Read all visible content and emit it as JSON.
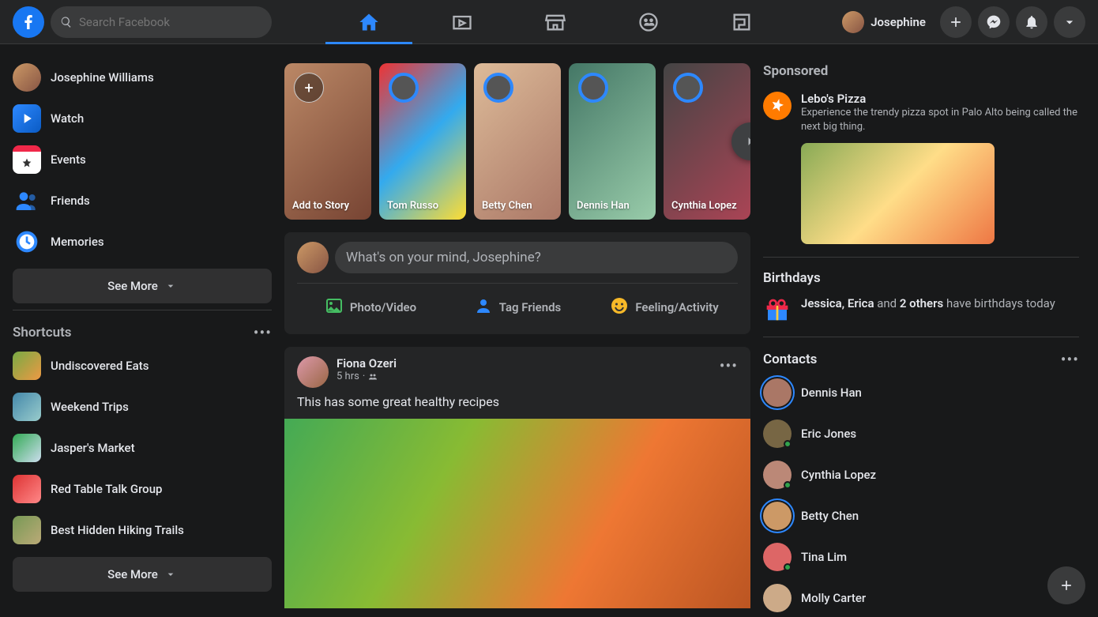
{
  "header": {
    "search_placeholder": "Search Facebook",
    "user_name": "Josephine"
  },
  "sidebar": {
    "profile_name": "Josephine Williams",
    "items": [
      {
        "label": "Watch"
      },
      {
        "label": "Events"
      },
      {
        "label": "Friends"
      },
      {
        "label": "Memories"
      }
    ],
    "see_more": "See More",
    "shortcuts_title": "Shortcuts",
    "shortcuts": [
      {
        "label": "Undiscovered Eats"
      },
      {
        "label": "Weekend Trips"
      },
      {
        "label": "Jasper's Market"
      },
      {
        "label": "Red Table Talk Group"
      },
      {
        "label": "Best Hidden Hiking Trails"
      }
    ],
    "see_more2": "See More"
  },
  "stories": [
    {
      "label": "Add to Story",
      "add": true
    },
    {
      "label": "Tom Russo"
    },
    {
      "label": "Betty Chen"
    },
    {
      "label": "Dennis Han"
    },
    {
      "label": "Cynthia Lopez"
    }
  ],
  "composer": {
    "placeholder": "What's on your mind, Josephine?",
    "actions": [
      {
        "label": "Photo/Video"
      },
      {
        "label": "Tag Friends"
      },
      {
        "label": "Feeling/Activity"
      }
    ]
  },
  "post": {
    "author": "Fiona Ozeri",
    "time": "5 hrs",
    "text": "This has some great healthy recipes"
  },
  "sponsored": {
    "title": "Sponsored",
    "name": "Lebo's Pizza",
    "desc": "Experience the trendy pizza spot in Palo Alto being called the next big thing."
  },
  "birthdays": {
    "title": "Birthdays",
    "names": "Jessica, Erica",
    "and_text": " and ",
    "others": "2 others",
    "suffix": " have birthdays today"
  },
  "contacts": {
    "title": "Contacts",
    "list": [
      {
        "name": "Dennis Han",
        "ring": true,
        "online": false
      },
      {
        "name": "Eric Jones",
        "ring": false,
        "online": true
      },
      {
        "name": "Cynthia Lopez",
        "ring": false,
        "online": true
      },
      {
        "name": "Betty Chen",
        "ring": true,
        "online": false
      },
      {
        "name": "Tina Lim",
        "ring": false,
        "online": true
      },
      {
        "name": "Molly Carter",
        "ring": false,
        "online": false
      }
    ]
  }
}
